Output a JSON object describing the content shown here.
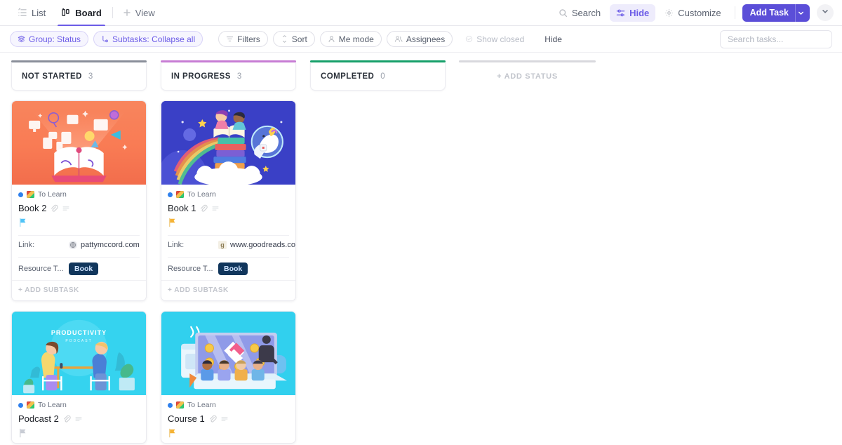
{
  "topbar": {
    "views": [
      {
        "label": "List",
        "icon": "list-icon",
        "active": false
      },
      {
        "label": "Board",
        "icon": "board-icon",
        "active": true
      }
    ],
    "add_view_label": "View",
    "actions": [
      {
        "label": "Search",
        "icon": "search-icon",
        "highlight": false
      },
      {
        "label": "Hide",
        "icon": "sliders-icon",
        "highlight": true
      },
      {
        "label": "Customize",
        "icon": "gear-icon",
        "highlight": false
      }
    ],
    "add_task_label": "Add Task",
    "accent_color": "#5b4ed8"
  },
  "filterbar": {
    "pills": [
      {
        "label": "Group: Status",
        "icon": "layers-icon",
        "style": "violet"
      },
      {
        "label": "Subtasks: Collapse all",
        "icon": "subtask-icon",
        "style": "violet"
      },
      {
        "label": "Filters",
        "icon": "filter-icon",
        "style": "outline"
      },
      {
        "label": "Sort",
        "icon": "sort-icon",
        "style": "outline"
      },
      {
        "label": "Me mode",
        "icon": "person-icon",
        "style": "outline"
      },
      {
        "label": "Assignees",
        "icon": "people-icon",
        "style": "outline"
      },
      {
        "label": "Show closed",
        "icon": "check-circle-icon",
        "style": "ghost"
      },
      {
        "label": "Hide",
        "icon": "none",
        "style": "plain"
      }
    ],
    "search_placeholder": "Search tasks..."
  },
  "board": {
    "add_status_label": "+ ADD STATUS",
    "columns": [
      {
        "title": "NOT STARTED",
        "count": "3",
        "accent": "#8a8f9a",
        "cards": [
          {
            "cover": "book-imagination",
            "list_name": "To Learn",
            "title": "Book 2",
            "flag_color": "#4fc3f7",
            "fields": [
              {
                "label": "Link:",
                "value": "pattymccord.com",
                "favicon": "globe-icon",
                "type": "link"
              },
              {
                "label": "Resource T...",
                "value": "Book",
                "type": "tag"
              }
            ],
            "add_subtask_label": "+ ADD SUBTASK"
          },
          {
            "cover": "podcast-interview",
            "list_name": "To Learn",
            "title": "Podcast 2",
            "flag_color": "#c8ccd4",
            "fields": [],
            "add_subtask_label": ""
          }
        ]
      },
      {
        "title": "IN PROGRESS",
        "count": "3",
        "accent": "#c77dd4",
        "cards": [
          {
            "cover": "space-books",
            "list_name": "To Learn",
            "title": "Book 1",
            "flag_color": "#f5b335",
            "fields": [
              {
                "label": "Link:",
                "value": "www.goodreads.con",
                "favicon": "goodreads-icon",
                "type": "link"
              },
              {
                "label": "Resource T...",
                "value": "Book",
                "type": "tag"
              }
            ],
            "add_subtask_label": "+ ADD SUBTASK"
          },
          {
            "cover": "online-course",
            "list_name": "To Learn",
            "title": "Course 1",
            "flag_color": "#f5b335",
            "fields": [],
            "add_subtask_label": ""
          }
        ]
      },
      {
        "title": "COMPLETED",
        "count": "0",
        "accent": "#16a06a",
        "cards": []
      }
    ]
  }
}
